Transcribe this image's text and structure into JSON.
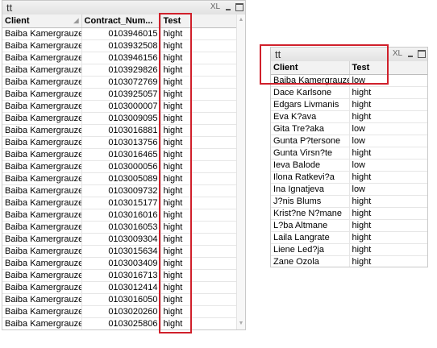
{
  "left_window": {
    "title": "tt",
    "xl": "XL",
    "columns": [
      "Client",
      "Contract_Num...",
      "Test"
    ],
    "rows": [
      [
        "Baiba Kamergrauze",
        "0103946015",
        "hight"
      ],
      [
        "Baiba Kamergrauze",
        "0103932508",
        "hight"
      ],
      [
        "Baiba Kamergrauze",
        "0103946156",
        "hight"
      ],
      [
        "Baiba Kamergrauze",
        "0103929826",
        "hight"
      ],
      [
        "Baiba Kamergrauze",
        "0103072769",
        "hight"
      ],
      [
        "Baiba Kamergrauze",
        "0103925057",
        "hight"
      ],
      [
        "Baiba Kamergrauze",
        "0103000007",
        "hight"
      ],
      [
        "Baiba Kamergrauze",
        "0103009095",
        "hight"
      ],
      [
        "Baiba Kamergrauze",
        "0103016881",
        "hight"
      ],
      [
        "Baiba Kamergrauze",
        "0103013756",
        "hight"
      ],
      [
        "Baiba Kamergrauze",
        "0103016465",
        "hight"
      ],
      [
        "Baiba Kamergrauze",
        "0103000056",
        "hight"
      ],
      [
        "Baiba Kamergrauze",
        "0103005089",
        "hight"
      ],
      [
        "Baiba Kamergrauze",
        "0103009732",
        "hight"
      ],
      [
        "Baiba Kamergrauze",
        "0103015177",
        "hight"
      ],
      [
        "Baiba Kamergrauze",
        "0103016016",
        "hight"
      ],
      [
        "Baiba Kamergrauze",
        "0103016053",
        "hight"
      ],
      [
        "Baiba Kamergrauze",
        "0103009304",
        "hight"
      ],
      [
        "Baiba Kamergrauze",
        "0103015634",
        "hight"
      ],
      [
        "Baiba Kamergrauze",
        "0103003409",
        "hight"
      ],
      [
        "Baiba Kamergrauze",
        "0103016713",
        "hight"
      ],
      [
        "Baiba Kamergrauze",
        "0103012414",
        "hight"
      ],
      [
        "Baiba Kamergrauze",
        "0103016050",
        "hight"
      ],
      [
        "Baiba Kamergrauze",
        "0103020260",
        "hight"
      ],
      [
        "Baiba Kamergrauze",
        "0103025806",
        "hight"
      ]
    ]
  },
  "right_window": {
    "title": "tt",
    "xl": "XL",
    "columns": [
      "Client",
      "Test"
    ],
    "rows": [
      [
        "Baiba Kamergrauze",
        "low"
      ],
      [
        "Dace Karlsone",
        "hight"
      ],
      [
        "Edgars Livmanis",
        "hight"
      ],
      [
        "Eva K?ava",
        "hight"
      ],
      [
        "Gita Tre?aka",
        "low"
      ],
      [
        "Gunta P?tersone",
        "low"
      ],
      [
        "Gunta Virsn?te",
        "hight"
      ],
      [
        "Ieva Balode",
        "low"
      ],
      [
        "Ilona Ratkevi?a",
        "hight"
      ],
      [
        "Ina Ignatjeva",
        "low"
      ],
      [
        "J?nis Blums",
        "hight"
      ],
      [
        "Krist?ne N?mane",
        "hight"
      ],
      [
        "L?ba Altmane",
        "hight"
      ],
      [
        "Laila Langrate",
        "hight"
      ],
      [
        "Liene Led?ja",
        "hight"
      ],
      [
        "Zane Ozola",
        "hight"
      ]
    ]
  },
  "colors": {
    "highlight": "#d0202b",
    "header_bg": "#f2f2f2"
  }
}
